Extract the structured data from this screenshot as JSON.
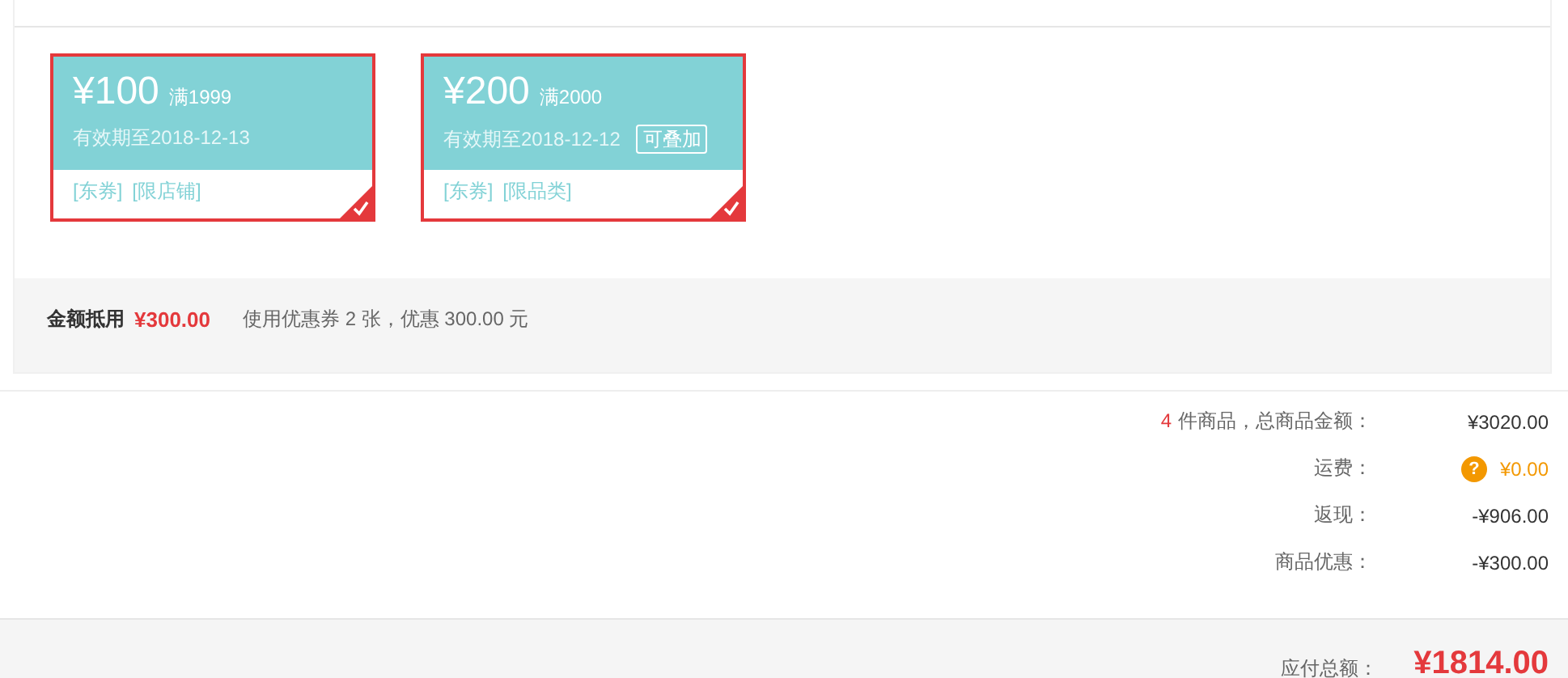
{
  "coupons": [
    {
      "amount": "¥100",
      "condition": "满1999",
      "validity": "有效期至2018-12-13",
      "tags": [
        "[东券]",
        "[限店铺]"
      ],
      "selected": true
    },
    {
      "amount": "¥200",
      "condition": "满2000",
      "validity": "有效期至2018-12-12",
      "badge": "可叠加",
      "tags": [
        "[东券]",
        "[限品类]"
      ],
      "selected": true
    }
  ],
  "deduction": {
    "label": "金额抵用",
    "amount": "¥300.00",
    "note": "使用优惠券 2 张，优惠 300.00 元"
  },
  "summary_rows": [
    {
      "kind": "count",
      "count": "4",
      "label": "件商品，总商品金额：",
      "value": "¥3020.00"
    },
    {
      "kind": "shipping",
      "label": "运费：",
      "help": "?",
      "value": "¥0.00"
    },
    {
      "kind": "plain",
      "label": "返现：",
      "value": "-¥906.00"
    },
    {
      "kind": "plain",
      "label": "商品优惠：",
      "value": "-¥300.00"
    }
  ],
  "total": {
    "label": "应付总额：",
    "value": "¥1814.00"
  }
}
